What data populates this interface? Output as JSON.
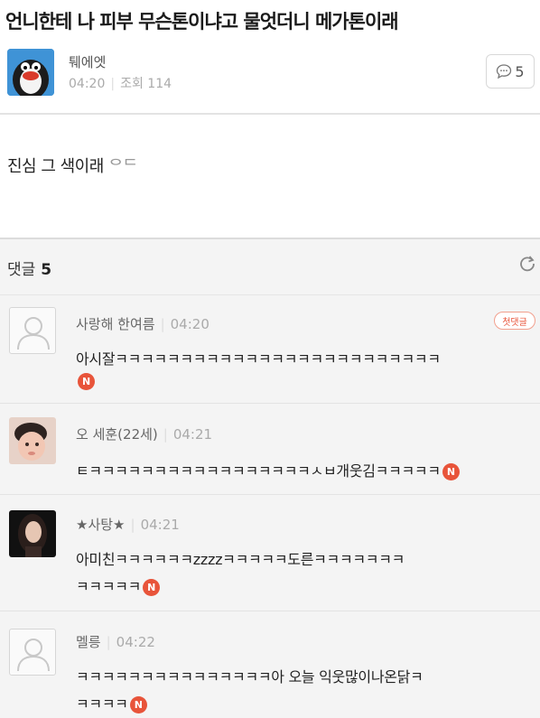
{
  "post": {
    "title": "언니한테 나 피부 무슨톤이냐고 물엇더니 메가톤이래",
    "author": "퉤에엣",
    "time": "04:20",
    "views": "조회 114",
    "comment_count": "5",
    "body": "진심 그 색이래 ",
    "body_emoji": "ᄋᄃ"
  },
  "comments_header": {
    "label": "댓글",
    "count": "5"
  },
  "badges": {
    "new": "N",
    "first_comment": "첫댓글"
  },
  "comments": [
    {
      "author": "사랑해 한여름",
      "time": "04:20",
      "lines": [
        "아시잘ㅋㅋㅋㅋㅋㅋㅋㅋㅋㅋㅋㅋㅋㅋㅋㅋㅋㅋㅋㅋㅋㅋㅋㅋㅋ",
        ""
      ],
      "avatar": "default-avatar-icon"
    },
    {
      "author": "오 세훈(22세)",
      "time": "04:21",
      "lines": [
        "ㅌㅋㅋㅋㅋㅋㅋㅋㅋㅋㅋㅋㅋㅋㅋㅋㅋㅋㅅㅂ개웃김ㅋㅋㅋㅋㅋ"
      ],
      "avatar": "baby-photo"
    },
    {
      "author": "★사탕★",
      "time": "04:21",
      "lines": [
        "아미친ㅋㅋㅋㅋㅋㅋzzzzㅋㅋㅋㅋㅋ도른ㅋㅋㅋㅋㅋㅋㅋ",
        "ㅋㅋㅋㅋㅋ"
      ],
      "avatar": "woman-photo"
    },
    {
      "author": "멜릉",
      "time": "04:22",
      "lines": [
        "ㅋㅋㅋㅋㅋㅋㅋㅋㅋㅋㅋㅋㅋㅋㅋ아 오늘 익웃많이나온닭ㅋ",
        "ㅋㅋㅋㅋ"
      ],
      "avatar": "default-avatar-icon"
    }
  ],
  "colors": {
    "accent": "#e8543a",
    "band": "#f4f4f4",
    "divider": "#e3e3e3"
  }
}
